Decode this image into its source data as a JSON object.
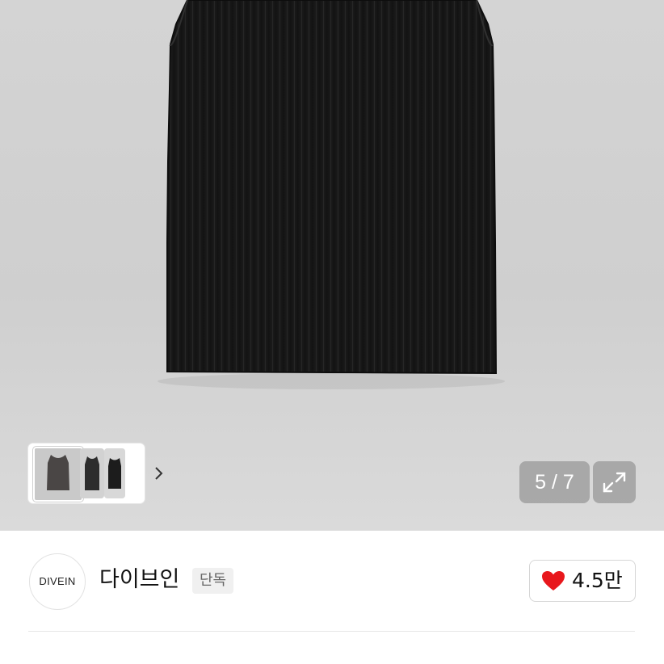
{
  "gallery": {
    "current_page": "5",
    "total_pages": "7",
    "page_indicator": "5 / 7",
    "thumbnail_count": 3
  },
  "brand": {
    "logo_text": "DIVEIN",
    "name": "다이브인",
    "badge": "단독"
  },
  "like": {
    "count": "4.5만",
    "heart_color": "#e8171c"
  },
  "icons": {
    "thumb_next": "chevron-right-icon",
    "expand": "expand-icon",
    "like": "heart-icon"
  }
}
